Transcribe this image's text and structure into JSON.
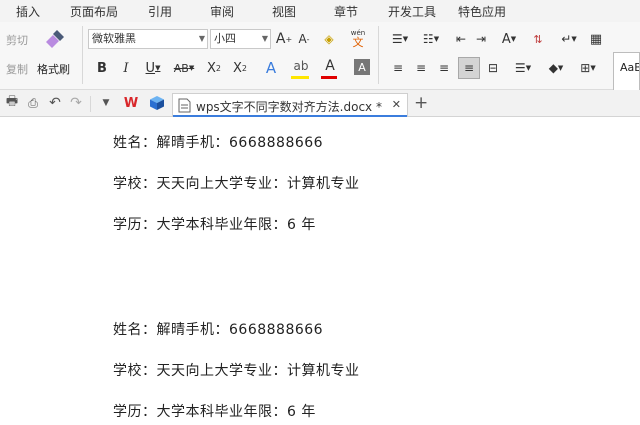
{
  "menu": {
    "tabs": [
      "插入",
      "页面布局",
      "引用",
      "审阅",
      "视图",
      "章节",
      "开发工具",
      "特色应用"
    ]
  },
  "ribbon": {
    "cut_label": "剪切",
    "copy_label": "复制",
    "format_painter_label": "格式刷",
    "font_name": "微软雅黑",
    "font_size": "小四",
    "style_preview": "AaB",
    "colors": {
      "highlight": "#ffe600",
      "font_color": "#e00000",
      "accent": "#3b7ddd"
    }
  },
  "tabbar": {
    "doc_title": "wps文字不同字数对齐方法.docx *",
    "close_symbol": "✕",
    "new_tab_symbol": "+"
  },
  "document": {
    "block1": {
      "line1": "姓名：解晴手机：6668888666",
      "line2": "学校：天天向上大学专业：计算机专业",
      "line3": "学历：大学本科毕业年限：6 年"
    },
    "block2": {
      "line1": "姓名：解晴手机：6668888666",
      "line2": "学校：天天向上大学专业：计算机专业",
      "line3": "学历：大学本科毕业年限：6 年"
    }
  }
}
